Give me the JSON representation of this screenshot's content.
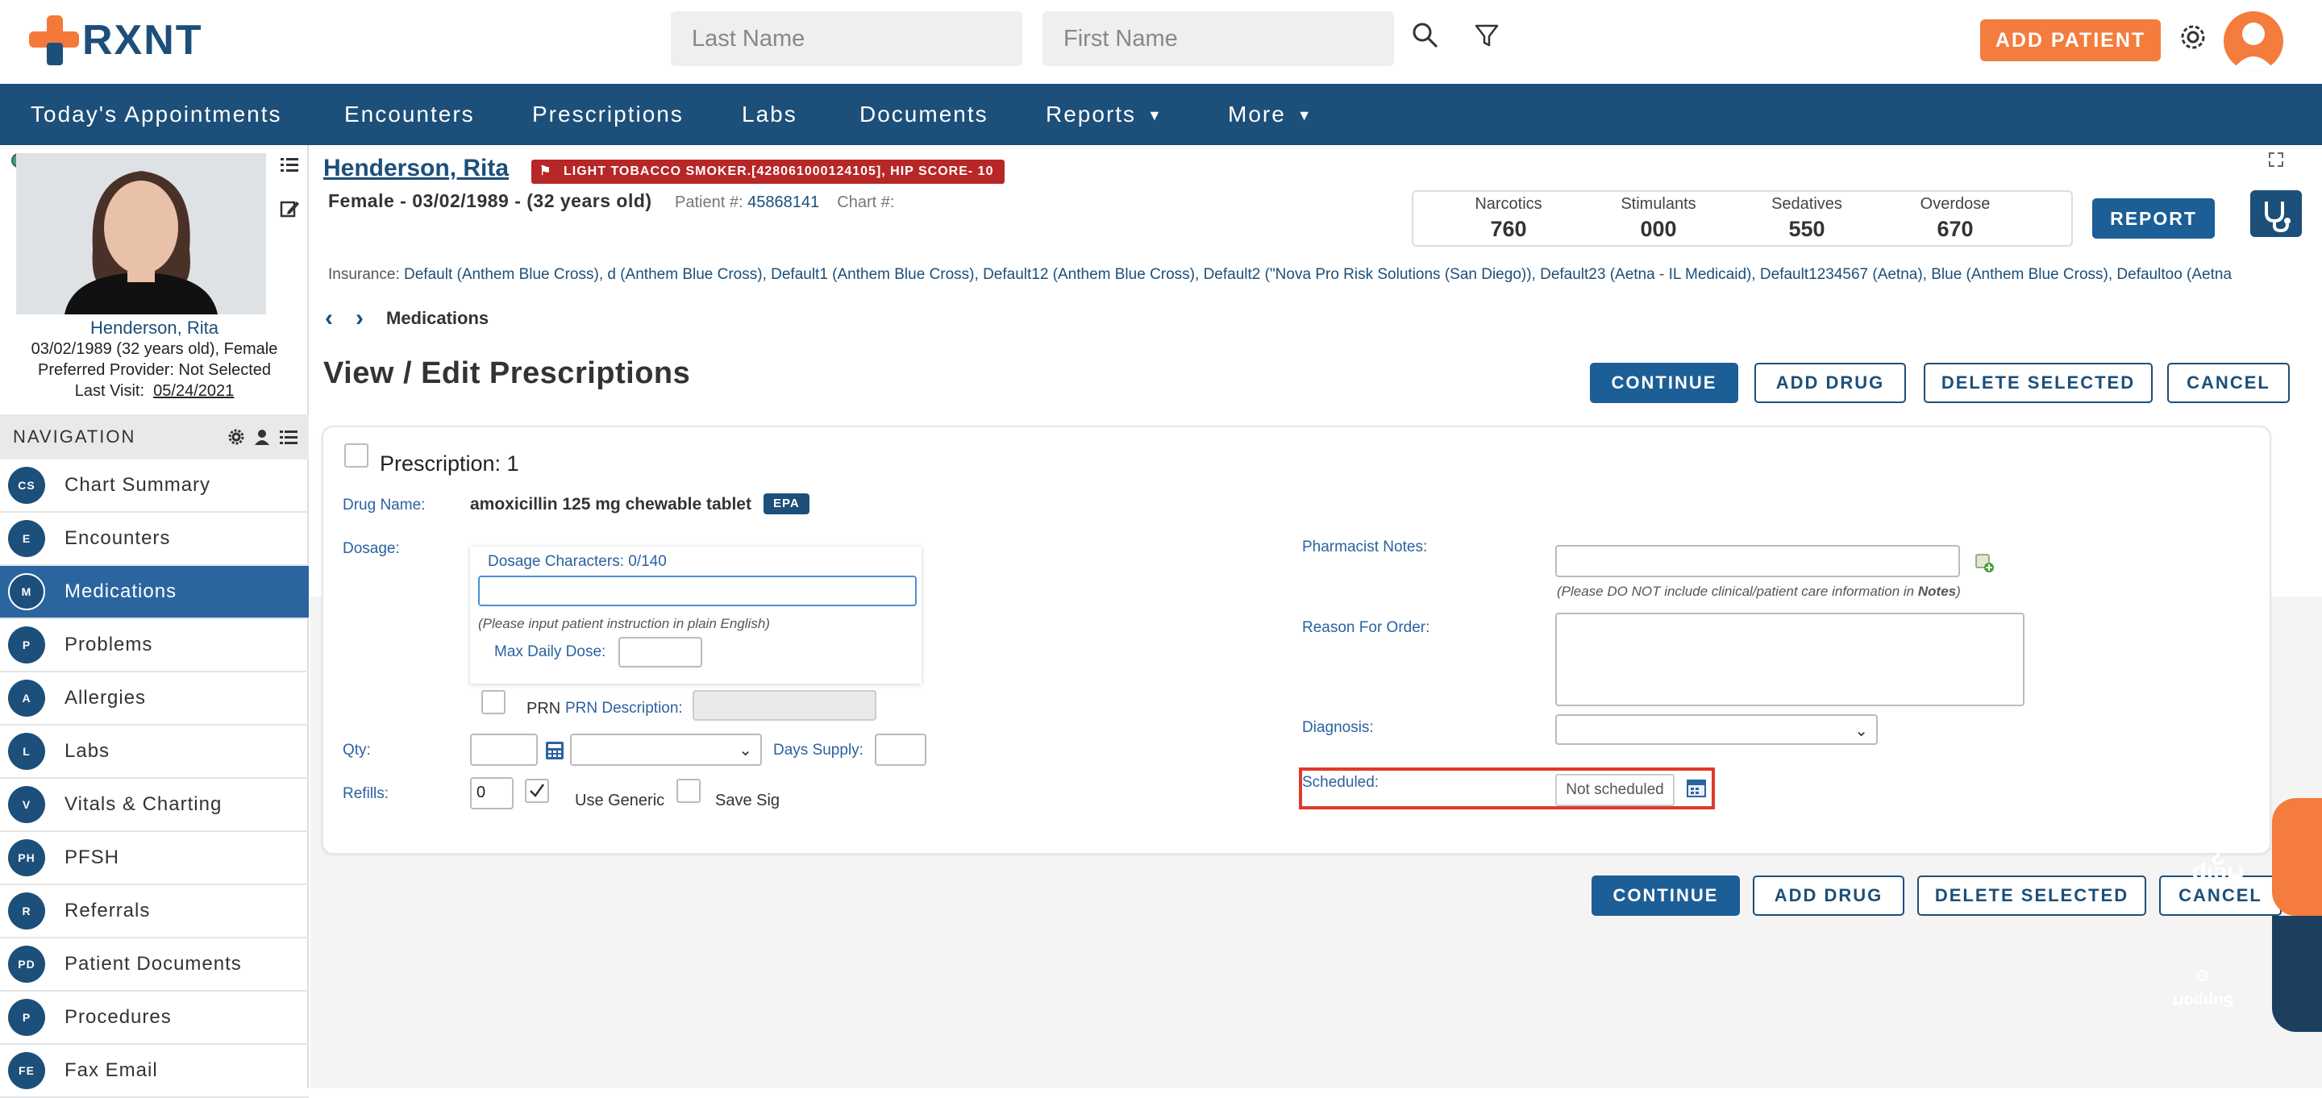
{
  "app": {
    "logo_text": "RXNT"
  },
  "search": {
    "last_name_placeholder": "Last Name",
    "first_name_placeholder": "First Name"
  },
  "topbar": {
    "add_patient_label": "ADD PATIENT"
  },
  "nav": {
    "items": [
      {
        "label": "Today's Appointments"
      },
      {
        "label": "Encounters"
      },
      {
        "label": "Prescriptions"
      },
      {
        "label": "Labs"
      },
      {
        "label": "Documents"
      },
      {
        "label": "Reports"
      },
      {
        "label": "More"
      }
    ]
  },
  "patient": {
    "name": "Henderson, Rita",
    "flag": "LIGHT TOBACCO SMOKER.[428061000124105], HIP SCORE- 10",
    "demographics": "Female - 03/02/1989 - (32 years old)",
    "patient_num_label": "Patient #:",
    "patient_num": "45868141",
    "chart_label": "Chart #:",
    "sidebar_name": "Henderson, Rita",
    "sidebar_dob": "03/02/1989 (32 years old), Female",
    "sidebar_provider": "Preferred Provider: Not Selected",
    "last_visit_label": "Last Visit:",
    "last_visit": "05/24/2021"
  },
  "stats": [
    {
      "label": "Narcotics",
      "value": "760"
    },
    {
      "label": "Stimulants",
      "value": "000"
    },
    {
      "label": "Sedatives",
      "value": "550"
    },
    {
      "label": "Overdose",
      "value": "670"
    }
  ],
  "report_label": "REPORT",
  "insurance": {
    "label": "Insurance:",
    "value": "Default (Anthem Blue Cross), d (Anthem Blue Cross), Default1 (Anthem Blue Cross), Default12 (Anthem Blue Cross), Default2 (\"Nova Pro Risk Solutions (San Diego)), Default23 (Aetna - IL Medicaid), Default1234567 (Aetna), Blue (Anthem Blue Cross), Defaultoo (Aetna"
  },
  "sidebar_nav": {
    "header": "NAVIGATION",
    "items": [
      {
        "badge": "CS",
        "label": "Chart Summary"
      },
      {
        "badge": "E",
        "label": "Encounters"
      },
      {
        "badge": "M",
        "label": "Medications"
      },
      {
        "badge": "P",
        "label": "Problems"
      },
      {
        "badge": "A",
        "label": "Allergies"
      },
      {
        "badge": "L",
        "label": "Labs"
      },
      {
        "badge": "V",
        "label": "Vitals & Charting"
      },
      {
        "badge": "PH",
        "label": "PFSH"
      },
      {
        "badge": "R",
        "label": "Referrals"
      },
      {
        "badge": "PD",
        "label": "Patient Documents"
      },
      {
        "badge": "P",
        "label": "Procedures"
      },
      {
        "badge": "FE",
        "label": "Fax Email"
      }
    ]
  },
  "breadcrumb": {
    "current": "Medications"
  },
  "page": {
    "title": "View / Edit Prescriptions"
  },
  "actions": {
    "continue": "CONTINUE",
    "add_drug": "ADD DRUG",
    "delete_selected": "DELETE SELECTED",
    "cancel": "CANCEL"
  },
  "rx": {
    "title": "Prescription: 1",
    "drug_name_label": "Drug Name:",
    "drug_name": "amoxicillin 125 mg chewable tablet",
    "epa_badge": "EPA",
    "dosage_label": "Dosage:",
    "dosage_chars": "Dosage Characters: 0/140",
    "dosage_value": "",
    "dosage_hint": "(Please input patient instruction in plain English)",
    "max_daily_dose_label": "Max Daily Dose:",
    "prn_label": "PRN",
    "prn_desc_label": "PRN Description:",
    "qty_label": "Qty:",
    "days_supply_label": "Days Supply:",
    "refills_label": "Refills:",
    "refills_value": "0",
    "use_generic_label": "Use Generic",
    "use_generic_checked": true,
    "save_sig_label": "Save Sig",
    "pharmacist_notes_label": "Pharmacist Notes:",
    "pharmacist_hint_prefix": "(Please DO NOT include clinical/patient care information in ",
    "pharmacist_hint_bold": "Notes",
    "pharmacist_hint_suffix": ")",
    "reason_label": "Reason For Order:",
    "diagnosis_label": "Diagnosis:",
    "scheduled_label": "Scheduled:",
    "scheduled_value": "Not scheduled"
  },
  "help": {
    "help_label": "Help",
    "support_label": "Support"
  },
  "colors": {
    "brand_navy": "#1c4f7a",
    "accent_orange": "#f47c3c",
    "flag_red": "#b82727",
    "highlight_red": "#e03a2a"
  }
}
